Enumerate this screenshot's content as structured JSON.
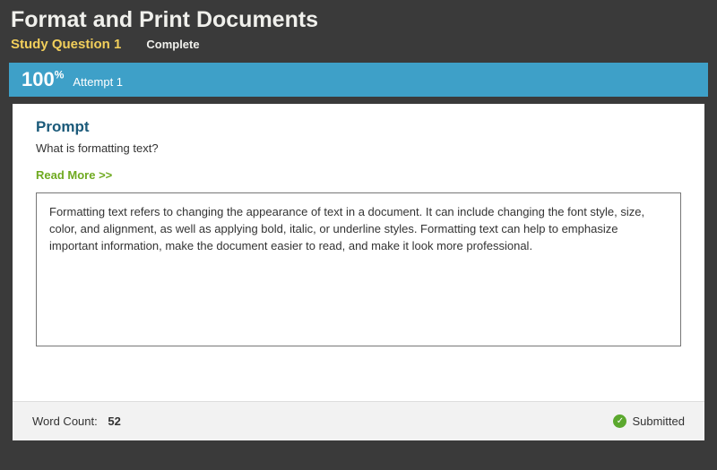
{
  "header": {
    "title": "Format and Print Documents",
    "question_label": "Study Question 1",
    "status": "Complete"
  },
  "score_bar": {
    "score_value": "100",
    "score_suffix": "%",
    "attempt_label": "Attempt 1"
  },
  "prompt": {
    "heading": "Prompt",
    "text": "What is formatting text?",
    "read_more": "Read More >>"
  },
  "answer": {
    "text": "Formatting text refers to changing the appearance of text in a document. It can include changing the font style, size, color, and alignment, as well as applying bold, italic, or underline styles. Formatting text can help to emphasize important information, make the document easier to read, and make it look more professional."
  },
  "footer": {
    "word_count_label": "Word Count:",
    "word_count_value": "52",
    "submitted_label": "Submitted"
  }
}
